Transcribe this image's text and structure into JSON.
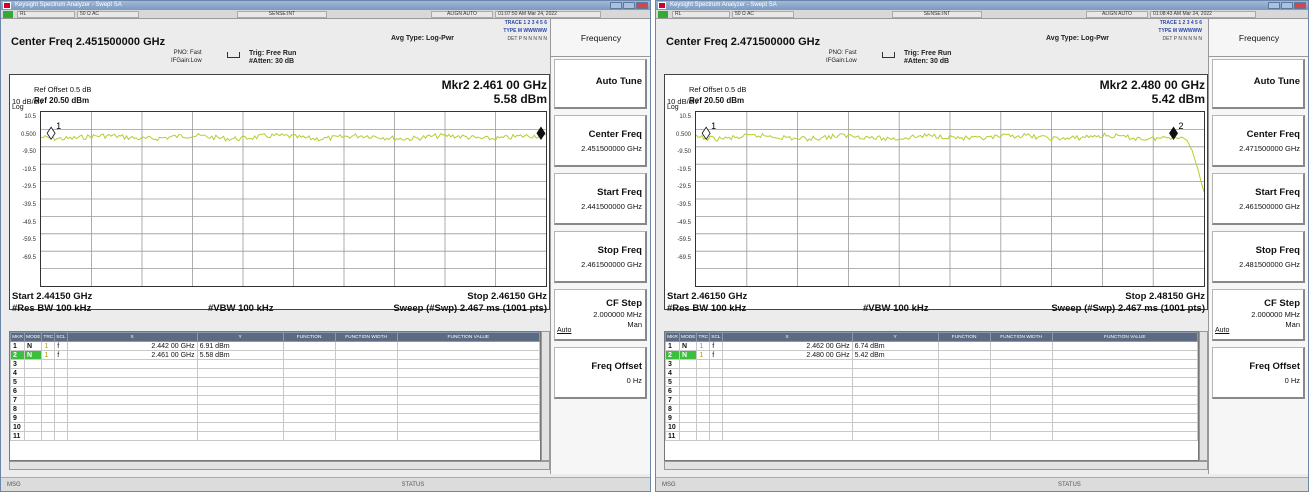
{
  "app_title": "Keysight Spectrum Analyzer - Swept SA",
  "windows": [
    {
      "status": {
        "rl": "RL",
        "dc": "50 Ω AC",
        "sense": "SENSE:INT",
        "align": "ALIGN AUTO",
        "timestamp": "01:07:50 AM Mar 24, 2022"
      },
      "center_freq": "Center Freq 2.451500000 GHz",
      "pno": "PNO: Fast",
      "ifgain": "IFGain:Low",
      "trig": "Trig: Free Run",
      "atten": "#Atten: 30 dB",
      "avg_type": "Avg Type: Log-Pwr",
      "trace_line": "TRACE 1 2 3 4 5 6",
      "type_line": "TYPE M WWWWW",
      "det_line": "DET P N N N N N",
      "ref_offset": "Ref Offset 0.5 dB",
      "div": "10 dB/div",
      "log": "Log",
      "ref_level": "Ref 20.50 dBm",
      "mkr_freq": "Mkr2 2.461 00 GHz",
      "mkr_level": "5.58 dBm",
      "scale_labels": [
        "10.5",
        "0.500",
        "-9.50",
        "-19.5",
        "-29.5",
        "-39.5",
        "-49.5",
        "-59.5",
        "-69.5"
      ],
      "start": "Start 2.44150 GHz",
      "stop": "Stop 2.46150 GHz",
      "res_bw": "#Res BW 100 kHz",
      "vbw": "#VBW 100 kHz",
      "sweep": "Sweep (#Swp)  2.467 ms (1001 pts)",
      "table_headers": [
        "MKR",
        "MODE",
        "TRC",
        "SCL",
        "X",
        "Y",
        "FUNCTION",
        "FUNCTION WIDTH",
        "FUNCTION VALUE"
      ],
      "markers": [
        {
          "n": "1",
          "mode": "N",
          "trc": "1",
          "scl": "f",
          "x": "2.442 00 GHz",
          "y": "6.91 dBm"
        },
        {
          "n": "2",
          "mode": "N",
          "trc": "1",
          "scl": "f",
          "x": "2.461 00 GHz",
          "y": "5.58 dBm"
        }
      ],
      "empty_rows": [
        "3",
        "4",
        "5",
        "6",
        "7",
        "8",
        "9",
        "10",
        "11"
      ],
      "msg": "MSG",
      "status_label": "STATUS",
      "softkeys": {
        "title": "Frequency",
        "auto_tune": "Auto Tune",
        "center_freq": "Center Freq",
        "center_val": "2.451500000 GHz",
        "start_freq": "Start Freq",
        "start_val": "2.441500000 GHz",
        "stop_freq": "Stop Freq",
        "stop_val": "2.461500000 GHz",
        "cf_step": "CF Step",
        "cf_step_val": "2.000000 MHz",
        "auto": "Auto",
        "man": "Man",
        "freq_offset": "Freq Offset",
        "freq_offset_val": "0 Hz"
      },
      "colors": {
        "trace": "#b7cc2e"
      },
      "trace_shape": "flat",
      "marker_positions": [
        0.02,
        0.99
      ]
    },
    {
      "status": {
        "rl": "RL",
        "dc": "50 Ω AC",
        "sense": "SENSE:INT",
        "align": "ALIGN AUTO",
        "timestamp": "01:08:43 AM Mar 24, 2022"
      },
      "center_freq": "Center Freq 2.471500000 GHz",
      "pno": "PNO: Fast",
      "ifgain": "IFGain:Low",
      "trig": "Trig: Free Run",
      "atten": "#Atten: 30 dB",
      "avg_type": "Avg Type: Log-Pwr",
      "trace_line": "TRACE 1 2 3 4 5 6",
      "type_line": "TYPE M WWWWW",
      "det_line": "DET P N N N N N",
      "ref_offset": "Ref Offset 0.5 dB",
      "div": "10 dB/div",
      "log": "Log",
      "ref_level": "Ref 20.50 dBm",
      "mkr_freq": "Mkr2 2.480 00 GHz",
      "mkr_level": "5.42 dBm",
      "scale_labels": [
        "10.5",
        "0.500",
        "-9.50",
        "-19.5",
        "-29.5",
        "-39.5",
        "-49.5",
        "-59.5",
        "-69.5"
      ],
      "start": "Start 2.46150 GHz",
      "stop": "Stop 2.48150 GHz",
      "res_bw": "#Res BW 100 kHz",
      "vbw": "#VBW 100 kHz",
      "sweep": "Sweep (#Swp)  2.467 ms (1001 pts)",
      "table_headers": [
        "MKR",
        "MODE",
        "TRC",
        "SCL",
        "X",
        "Y",
        "FUNCTION",
        "FUNCTION WIDTH",
        "FUNCTION VALUE"
      ],
      "markers": [
        {
          "n": "1",
          "mode": "N",
          "trc": "1",
          "scl": "f",
          "x": "2.462 00 GHz",
          "y": "6.74 dBm"
        },
        {
          "n": "2",
          "mode": "N",
          "trc": "1",
          "scl": "f",
          "x": "2.480 00 GHz",
          "y": "5.42 dBm"
        }
      ],
      "empty_rows": [
        "3",
        "4",
        "5",
        "6",
        "7",
        "8",
        "9",
        "10",
        "11"
      ],
      "msg": "MSG",
      "status_label": "STATUS",
      "softkeys": {
        "title": "Frequency",
        "auto_tune": "Auto Tune",
        "center_freq": "Center Freq",
        "center_val": "2.471500000 GHz",
        "start_freq": "Start Freq",
        "start_val": "2.461500000 GHz",
        "stop_freq": "Stop Freq",
        "stop_val": "2.481500000 GHz",
        "cf_step": "CF Step",
        "cf_step_val": "2.000000 MHz",
        "auto": "Auto",
        "man": "Man",
        "freq_offset": "Freq Offset",
        "freq_offset_val": "0 Hz"
      },
      "colors": {
        "trace": "#b7cc2e"
      },
      "trace_shape": "band_edge",
      "marker_positions": [
        0.02,
        0.94
      ]
    }
  ]
}
